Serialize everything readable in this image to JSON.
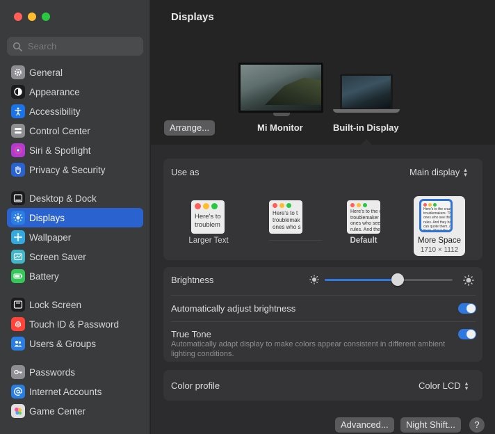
{
  "colors": {
    "accent": "#2a63d0",
    "traffic_red": "#ff5f57",
    "traffic_yellow": "#febc2e",
    "traffic_green": "#28c840"
  },
  "sidebar": {
    "search_placeholder": "Search",
    "items": [
      {
        "label": "General",
        "icon": "gear-icon",
        "color": "#8e8e93"
      },
      {
        "label": "Appearance",
        "icon": "appearance-icon",
        "color": "#1c1c1e"
      },
      {
        "label": "Accessibility",
        "icon": "accessibility-icon",
        "color": "#1a73e8"
      },
      {
        "label": "Control Center",
        "icon": "control-center-icon",
        "color": "#8e8e93"
      },
      {
        "label": "Siri & Spotlight",
        "icon": "siri-icon",
        "color": "#b23bd1"
      },
      {
        "label": "Privacy & Security",
        "icon": "hand-icon",
        "color": "#2a63d0"
      },
      {
        "label": "Desktop & Dock",
        "icon": "dock-icon",
        "color": "#1c1c1e"
      },
      {
        "label": "Displays",
        "icon": "sun-icon",
        "color": "#2a7de1",
        "active": true
      },
      {
        "label": "Wallpaper",
        "icon": "wallpaper-icon",
        "color": "#33a9e0"
      },
      {
        "label": "Screen Saver",
        "icon": "screen-saver-icon",
        "color": "#3fb6c9"
      },
      {
        "label": "Battery",
        "icon": "battery-icon",
        "color": "#34c759"
      },
      {
        "label": "Lock Screen",
        "icon": "lock-icon",
        "color": "#1c1c1e"
      },
      {
        "label": "Touch ID & Password",
        "icon": "fingerprint-icon",
        "color": "#ff453a"
      },
      {
        "label": "Users & Groups",
        "icon": "users-icon",
        "color": "#2a7de1"
      },
      {
        "label": "Passwords",
        "icon": "key-icon",
        "color": "#8e8e93"
      },
      {
        "label": "Internet Accounts",
        "icon": "at-icon",
        "color": "#2a7de1"
      },
      {
        "label": "Game Center",
        "icon": "game-center-icon",
        "color": "#e0e0e0"
      }
    ]
  },
  "main": {
    "title": "Displays",
    "arrange_button": "Arrange...",
    "displays": [
      "Mi Monitor",
      "Built-in Display"
    ],
    "use_as_label": "Use as",
    "use_as_value": "Main display",
    "resolution_options": [
      {
        "label": "Larger Text",
        "preview": "Here's to\ntroublem"
      },
      {
        "label": "",
        "preview": "Here's to t\ntroublemak\nones who s"
      },
      {
        "label": "Default",
        "preview": "Here's to the c\ntroublemaker\nones who see\nrules. And they"
      },
      {
        "label": "More Space",
        "sublabel": "1710 × 1112",
        "preview": "Here's to the crazy one\ntroublemakers. The rou\nones who see things diff\nrules. And they have no\ncan quote them, disagre\nthem. About the only th\nBecause they change"
      }
    ],
    "brightness_label": "Brightness",
    "brightness_value": 0.57,
    "auto_brightness_label": "Automatically adjust brightness",
    "auto_brightness_on": true,
    "true_tone_label": "True Tone",
    "true_tone_description": "Automatically adapt display to make colors appear consistent in different ambient lighting conditions.",
    "true_tone_on": true,
    "color_profile_label": "Color profile",
    "color_profile_value": "Color LCD",
    "advanced_button": "Advanced...",
    "night_shift_button": "Night Shift...",
    "help_button": "?"
  }
}
